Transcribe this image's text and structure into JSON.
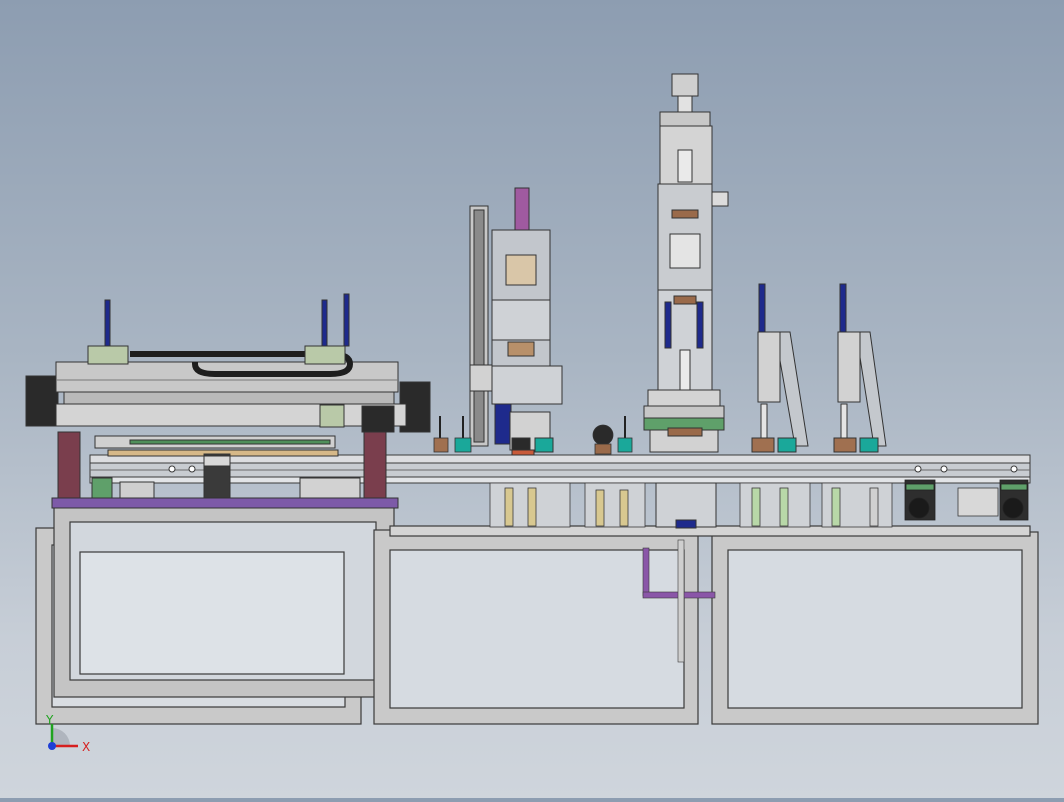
{
  "viewport": {
    "background_top": "#8d9db1",
    "background_bottom": "#cfd5dc"
  },
  "triad": {
    "x_label": "X",
    "y_label": "Y",
    "x_color": "#d61f1f",
    "y_color": "#1fa31f",
    "z_color": "#1d3fd6"
  },
  "colors": {
    "frame": "#c9c9c9",
    "frame_edge": "#3a3a3a",
    "rail": "#d8dadc",
    "maroon": "#7a3e4d",
    "purple": "#7d5aa8",
    "navy_cylinder": "#1e2a8c",
    "teal": "#1aa89a",
    "olive": "#b9c9a8",
    "bronze": "#9a6a4a",
    "dark_motor": "#2a2a2a"
  }
}
